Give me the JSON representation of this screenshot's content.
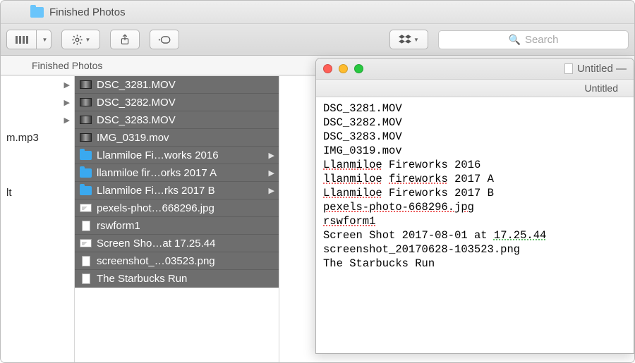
{
  "finder": {
    "window_title": "Finished Photos",
    "path_label": "Finished Photos",
    "search_placeholder": "Search",
    "toolbar_icons": {
      "columns": "columns-view-icon",
      "gear": "gear-icon",
      "share": "share-icon",
      "tags": "tags-icon",
      "dropbox": "dropbox-icon"
    },
    "left_column": {
      "items": [
        {
          "label": "",
          "has_chevron": true
        },
        {
          "label": "",
          "has_chevron": true,
          "selected_hint": true
        },
        {
          "label": "",
          "has_chevron": true
        },
        {
          "label": "m.mp3",
          "has_chevron": false
        },
        {
          "label": "",
          "has_chevron": false
        },
        {
          "label": "lt",
          "has_chevron": false
        }
      ]
    },
    "files": [
      {
        "name": "DSC_3281.MOV",
        "icon": "mov",
        "folder": false
      },
      {
        "name": "DSC_3282.MOV",
        "icon": "mov",
        "folder": false
      },
      {
        "name": "DSC_3283.MOV",
        "icon": "mov",
        "folder": false
      },
      {
        "name": "IMG_0319.mov",
        "icon": "mov",
        "folder": false
      },
      {
        "name": "Llanmiloe Fi…works 2016",
        "icon": "folder",
        "folder": true
      },
      {
        "name": "llanmiloe fir…orks 2017 A",
        "icon": "folder",
        "folder": true
      },
      {
        "name": "Llanmiloe Fi…rks 2017 B",
        "icon": "folder",
        "folder": true
      },
      {
        "name": "pexels-phot…668296.jpg",
        "icon": "img",
        "folder": false
      },
      {
        "name": "rswform1",
        "icon": "doc",
        "folder": false
      },
      {
        "name": "Screen Sho…at 17.25.44",
        "icon": "img",
        "folder": false
      },
      {
        "name": "screenshot_…03523.png",
        "icon": "doc",
        "folder": false
      },
      {
        "name": "The Starbucks Run",
        "icon": "doc",
        "folder": false
      }
    ]
  },
  "textedit": {
    "title_prefix": "Untitled —",
    "tab_label": "Untitled",
    "lines": [
      "DSC_3281.MOV",
      "DSC_3282.MOV",
      "DSC_3283.MOV",
      "IMG_0319.mov",
      "Llanmiloe Fireworks 2016",
      "llanmiloe fireworks 2017 A",
      "Llanmiloe Fireworks 2017 B",
      "pexels-photo-668296.jpg",
      "rswform1",
      "Screen Shot 2017-08-01 at 17.25.44",
      "screenshot_20170628-103523.png",
      "The Starbucks Run"
    ],
    "spellcheck": {
      "red_tokens": [
        "Llanmiloe",
        "llanmiloe",
        "fireworks",
        "pexels-photo-668296.jpg",
        "rswform1"
      ],
      "green_tokens": [
        "17.25.44"
      ]
    }
  }
}
